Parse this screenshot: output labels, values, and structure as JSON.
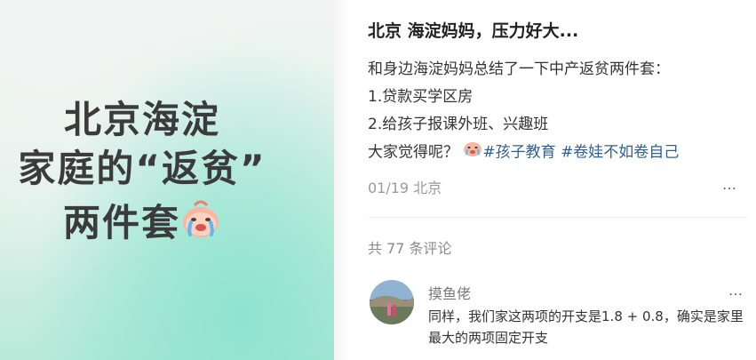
{
  "cover": {
    "line1": "北京海淀",
    "line1_plain": "北京",
    "line1_highlight": "海淀",
    "line2": "家庭的“返贫”",
    "line3": "两件套",
    "emoji_icon": "crying-face-icon",
    "highlight_color": "#ffe98c"
  },
  "post": {
    "title": "北京 海淀妈妈，压力好大...",
    "body_line1": "和身边海淀妈妈总结了一下中产返贫两件套：",
    "body_line2": "1.贷款买学区房",
    "body_line3": "2.给孩子报课外班、兴趣班",
    "body_line4_text": "大家觉得呢？ ",
    "tag1": "#孩子教育",
    "tag2": "#卷娃不如卷自己",
    "tag_color": "#2f5f93",
    "meta": "01/19 北京",
    "more": "…"
  },
  "comments": {
    "count_label": "共 77 条评论",
    "items": [
      {
        "author": "摸鱼佬",
        "text": "同样，我们家这两项的开支是1.8 + 0.8，确实是家里最大的两项固定开支",
        "more": "…"
      }
    ]
  }
}
